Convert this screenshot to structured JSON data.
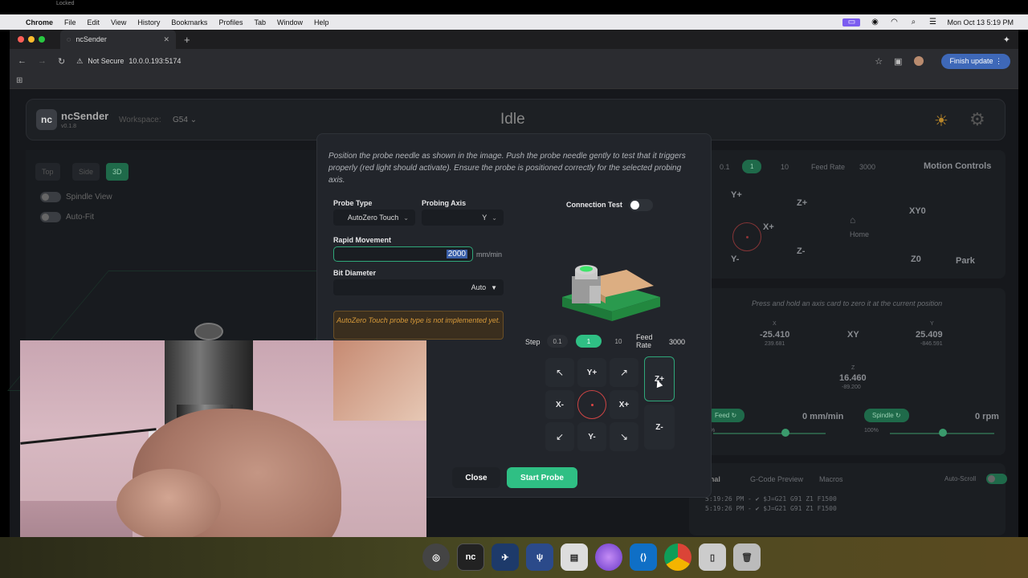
{
  "top_strip": {
    "text": "Locked"
  },
  "menubar": {
    "app_name": "Chrome",
    "items": [
      "File",
      "Edit",
      "View",
      "History",
      "Bookmarks",
      "Profiles",
      "Tab",
      "Window",
      "Help"
    ],
    "datetime": "Mon Oct 13  5:19 PM"
  },
  "browser": {
    "tab_title": "ncSender",
    "security": "Not Secure",
    "url": "10.0.0.193:5174",
    "update_button": "Finish update"
  },
  "app": {
    "brand": "ncSender",
    "version": "v0.1.8",
    "workspace_label": "Workspace:",
    "workspace_value": "G54",
    "machine_state": "Idle",
    "view_buttons": [
      "Top",
      "Side",
      "3D"
    ],
    "toggles": [
      "Spindle View",
      "Auto-Fit"
    ],
    "right": {
      "step_values": [
        "0.1",
        "1",
        "10"
      ],
      "feed_label": "Feed Rate",
      "feed_value": "3000",
      "motion_title": "Motion Controls",
      "jog": {
        "yplus": "Y+",
        "yminus": "Y-",
        "xplus": "X+",
        "zplus": "Z+",
        "zminus": "Z-",
        "home": "Home",
        "xy0": "XY0",
        "z0": "Z0",
        "park": "Park"
      },
      "zero_hint": "Press and hold an axis card to zero it at the current position",
      "x_label": "X",
      "x_value": "-25.410",
      "x_sub": "239.681",
      "xy_label": "XY",
      "y_label": "Y",
      "y_value": "25.409",
      "y_sub": "-846.591",
      "z_label": "Z",
      "z_value": "16.460",
      "z_sub": "-89.200",
      "feed_btn": "Feed ↻",
      "feed_rate": "0 mm/min",
      "feed_pct": "%",
      "spindle_btn": "Spindle ↻",
      "spindle_rate": "0 rpm",
      "spindle_pct": "100%",
      "tabs": [
        "Terminal",
        "G-Code Preview",
        "Macros"
      ],
      "autoscroll": "Auto-Scroll",
      "terminal_lines": [
        "5:19:26 PM - ✔ $J=G21 G91 Z1 F1500",
        "5:19:26 PM - ✔ $J=G21 G91 Z1 F1500"
      ]
    }
  },
  "modal": {
    "description": "Position the probe needle as shown in the image. Push the probe needle gently to test that it triggers properly (red light should activate). Ensure the probe is positioned correctly for the selected probing axis.",
    "probe_type_label": "Probe Type",
    "probe_type_value": "AutoZero Touch",
    "probing_axis_label": "Probing Axis",
    "probing_axis_value": "Y",
    "rapid_label": "Rapid Movement",
    "rapid_value": "2000",
    "rapid_unit": "mm/min",
    "bit_label": "Bit Diameter",
    "bit_value": "Auto",
    "warning": "AutoZero Touch probe type is not implemented yet.",
    "connection_test_label": "Connection Test",
    "step_label": "Step",
    "steps": [
      "0.1",
      "1",
      "10"
    ],
    "feed_label": "Feed Rate",
    "feed_value": "3000",
    "jog": {
      "yplus": "Y+",
      "yminus": "Y-",
      "xplus": "X+",
      "xminus": "X-",
      "zplus": "Z+",
      "zminus": "Z-"
    },
    "close_button": "Close",
    "start_button": "Start Probe"
  },
  "dock": {
    "apps": [
      "nc"
    ]
  }
}
